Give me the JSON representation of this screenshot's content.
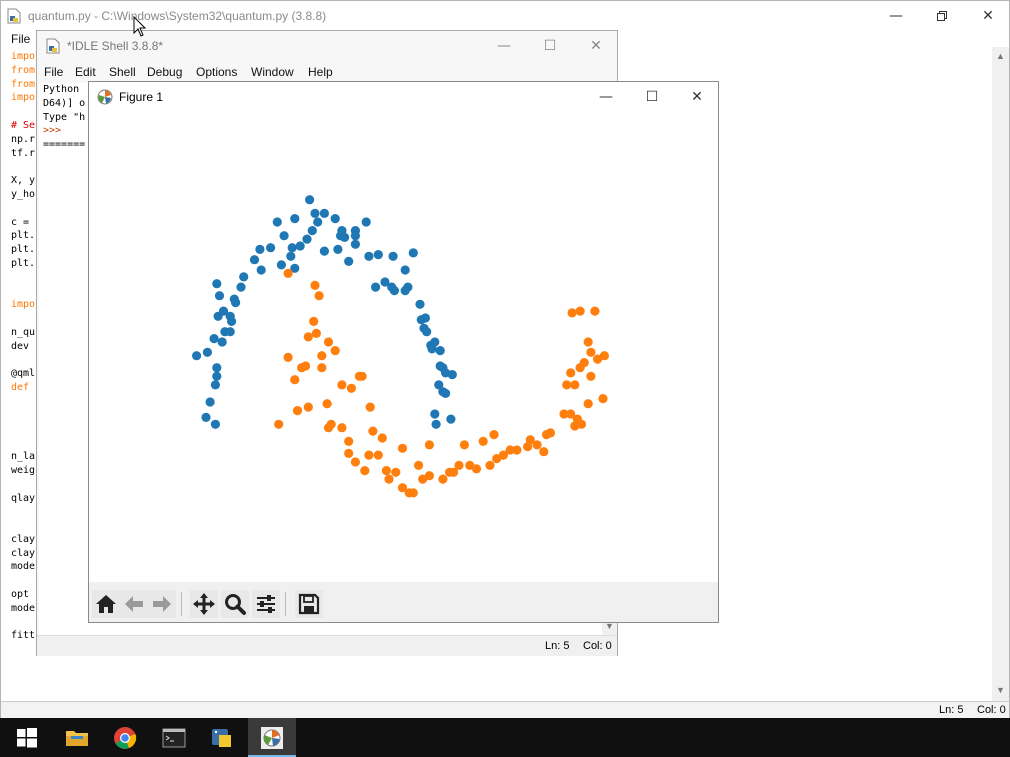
{
  "editor": {
    "title": "quantum.py - C:\\Windows\\System32\\quantum.py (3.8.8)",
    "menu": [
      "File"
    ],
    "code_lines": [
      {
        "text": "impo",
        "color": "#ff7700"
      },
      {
        "text": "from",
        "color": "#ff7700"
      },
      {
        "text": "from",
        "color": "#ff7700"
      },
      {
        "text": "impo",
        "color": "#ff7700"
      },
      {
        "text": "",
        "color": "#000000"
      },
      {
        "text": "# Se",
        "color": "#dd0000"
      },
      {
        "text": "np.r",
        "color": "#000000"
      },
      {
        "text": "tf.r",
        "color": "#000000"
      },
      {
        "text": "",
        "color": "#000000"
      },
      {
        "text": "X, y",
        "color": "#000000"
      },
      {
        "text": "y_ho",
        "color": "#000000"
      },
      {
        "text": "",
        "color": "#000000"
      },
      {
        "text": "c = ",
        "color": "#000000"
      },
      {
        "text": "plt.",
        "color": "#000000"
      },
      {
        "text": "plt.",
        "color": "#000000"
      },
      {
        "text": "plt.",
        "color": "#000000"
      },
      {
        "text": "",
        "color": "#000000"
      },
      {
        "text": "",
        "color": "#000000"
      },
      {
        "text": "impo",
        "color": "#ff7700"
      },
      {
        "text": "",
        "color": "#000000"
      },
      {
        "text": "n_qu",
        "color": "#000000"
      },
      {
        "text": "dev ",
        "color": "#000000"
      },
      {
        "text": "",
        "color": "#000000"
      },
      {
        "text": "@qml",
        "color": "#000000"
      },
      {
        "text": "def ",
        "color": "#ff7700"
      },
      {
        "text": "",
        "color": "#000000"
      },
      {
        "text": "",
        "color": "#000000"
      },
      {
        "text": "",
        "color": "#000000"
      },
      {
        "text": "",
        "color": "#000000"
      },
      {
        "text": "n_la",
        "color": "#000000"
      },
      {
        "text": "weig",
        "color": "#000000"
      },
      {
        "text": "",
        "color": "#000000"
      },
      {
        "text": "qlay",
        "color": "#000000"
      },
      {
        "text": "",
        "color": "#000000"
      },
      {
        "text": "",
        "color": "#000000"
      },
      {
        "text": "clay",
        "color": "#000000"
      },
      {
        "text": "clay",
        "color": "#000000"
      },
      {
        "text": "mode",
        "color": "#000000"
      },
      {
        "text": "",
        "color": "#000000"
      },
      {
        "text": "opt ",
        "color": "#000000"
      },
      {
        "text": "mode",
        "color": "#000000"
      },
      {
        "text": "",
        "color": "#000000"
      },
      {
        "text": "fitt",
        "color": "#000000"
      }
    ],
    "status_ln": "Ln: 5",
    "status_col": "Col: 0"
  },
  "shell": {
    "title": "*IDLE Shell 3.8.8*",
    "menu": [
      "File",
      "Edit",
      "Shell",
      "Debug",
      "Options",
      "Window",
      "Help"
    ],
    "lines": [
      {
        "text": "Python",
        "color": "#000000"
      },
      {
        "text": "D64)] o",
        "color": "#000000"
      },
      {
        "text": "Type \"h",
        "color": "#000000"
      },
      {
        "text": ">>>",
        "color": "#c04000"
      },
      {
        "text": "=======",
        "color": "#000000"
      }
    ],
    "status_ln": "Ln: 5",
    "status_col": "Col: 0"
  },
  "figure": {
    "title": "Figure 1",
    "toolbar": [
      "home-icon",
      "back-icon",
      "forward-icon",
      "pan-icon",
      "zoom-icon",
      "configure-icon",
      "save-icon"
    ]
  },
  "colors": {
    "series_blue": "#1f77b4",
    "series_orange": "#ff7f0e",
    "idle_keyword": "#ff7700",
    "idle_comment": "#dd0000"
  },
  "chart_data": {
    "type": "scatter",
    "xlim": [
      -1.25,
      2.25
    ],
    "ylim": [
      -0.75,
      1.35
    ],
    "series": [
      {
        "color": "#1f77b4",
        "points": [
          [
            -1.03,
            0.22
          ],
          [
            -0.93,
            -0.05
          ],
          [
            -0.96,
            -0.14
          ],
          [
            -0.89,
            -0.18
          ],
          [
            -0.95,
            0.24
          ],
          [
            -0.9,
            0.32
          ],
          [
            -0.89,
            0.05
          ],
          [
            -0.88,
            0.1
          ],
          [
            -0.84,
            0.3
          ],
          [
            -0.88,
            0.15
          ],
          [
            -0.87,
            0.45
          ],
          [
            -0.83,
            0.48
          ],
          [
            -0.78,
            0.45
          ],
          [
            -0.82,
            0.36
          ],
          [
            -0.78,
            0.36
          ],
          [
            -0.77,
            0.42
          ],
          [
            -0.75,
            0.55
          ],
          [
            -0.74,
            0.53
          ],
          [
            -0.7,
            0.62
          ],
          [
            -0.68,
            0.68
          ],
          [
            -0.88,
            0.64
          ],
          [
            -0.86,
            0.57
          ],
          [
            -0.56,
            0.84
          ],
          [
            -0.48,
            0.85
          ],
          [
            -0.43,
            1.0
          ],
          [
            -0.38,
            0.92
          ],
          [
            -0.3,
            1.02
          ],
          [
            -0.19,
            1.13
          ],
          [
            -0.33,
            0.8
          ],
          [
            -0.21,
            0.9
          ],
          [
            -0.15,
            1.05
          ],
          [
            -0.08,
            1.05
          ],
          [
            0.0,
            1.02
          ],
          [
            -0.32,
            0.85
          ],
          [
            -0.26,
            0.86
          ],
          [
            -0.17,
            0.95
          ],
          [
            0.05,
            0.95
          ],
          [
            0.15,
            0.95
          ],
          [
            0.23,
            1.0
          ],
          [
            0.04,
            0.92
          ],
          [
            0.07,
            0.91
          ],
          [
            0.15,
            0.87
          ],
          [
            0.25,
            0.8
          ],
          [
            0.32,
            0.81
          ],
          [
            0.43,
            0.8
          ],
          [
            0.44,
            0.6
          ],
          [
            0.42,
            0.62
          ],
          [
            0.58,
            0.82
          ],
          [
            0.52,
            0.72
          ],
          [
            0.54,
            0.62
          ],
          [
            0.52,
            0.6
          ],
          [
            0.37,
            0.65
          ],
          [
            0.63,
            0.52
          ],
          [
            0.66,
            0.38
          ],
          [
            0.68,
            0.36
          ],
          [
            0.71,
            0.28
          ],
          [
            0.74,
            0.3
          ],
          [
            0.78,
            0.25
          ],
          [
            0.8,
            0.15
          ],
          [
            0.82,
            0.12
          ],
          [
            0.77,
            0.05
          ],
          [
            0.8,
            0.01
          ],
          [
            0.82,
            0.0
          ],
          [
            0.74,
            -0.12
          ],
          [
            0.86,
            -0.15
          ],
          [
            0.75,
            -0.18
          ],
          [
            0.87,
            0.11
          ],
          [
            0.72,
            0.26
          ],
          [
            -0.13,
            1.0
          ],
          [
            -0.6,
            0.78
          ],
          [
            -0.55,
            0.72
          ],
          [
            -0.3,
            0.73
          ],
          [
            -0.4,
            0.75
          ],
          [
            0.15,
            0.92
          ],
          [
            0.3,
            0.62
          ],
          [
            0.1,
            0.77
          ],
          [
            0.02,
            0.84
          ],
          [
            -0.08,
            0.83
          ],
          [
            0.67,
            0.44
          ],
          [
            0.64,
            0.43
          ],
          [
            0.78,
            0.16
          ]
        ]
      },
      {
        "color": "#ff7f0e",
        "points": [
          [
            -0.12,
            0.57
          ],
          [
            -0.22,
            0.16
          ],
          [
            -0.3,
            0.08
          ],
          [
            -0.42,
            -0.18
          ],
          [
            -0.28,
            -0.1
          ],
          [
            -0.2,
            -0.08
          ],
          [
            -0.25,
            0.15
          ],
          [
            -0.2,
            0.33
          ],
          [
            -0.16,
            0.42
          ],
          [
            -0.14,
            0.35
          ],
          [
            -0.06,
            -0.06
          ],
          [
            -0.03,
            -0.18
          ],
          [
            -0.05,
            -0.2
          ],
          [
            0.05,
            -0.2
          ],
          [
            0.1,
            -0.28
          ],
          [
            0.1,
            -0.35
          ],
          [
            0.15,
            -0.4
          ],
          [
            0.22,
            -0.45
          ],
          [
            0.25,
            -0.36
          ],
          [
            0.32,
            -0.36
          ],
          [
            0.38,
            -0.45
          ],
          [
            0.4,
            -0.5
          ],
          [
            0.45,
            -0.46
          ],
          [
            0.5,
            -0.55
          ],
          [
            0.55,
            -0.58
          ],
          [
            0.58,
            -0.58
          ],
          [
            0.62,
            -0.42
          ],
          [
            0.65,
            -0.5
          ],
          [
            0.7,
            -0.48
          ],
          [
            0.8,
            -0.5
          ],
          [
            0.85,
            -0.46
          ],
          [
            0.88,
            -0.46
          ],
          [
            0.92,
            -0.42
          ],
          [
            1.0,
            -0.42
          ],
          [
            1.05,
            -0.44
          ],
          [
            1.15,
            -0.42
          ],
          [
            1.2,
            -0.38
          ],
          [
            1.25,
            -0.36
          ],
          [
            1.3,
            -0.33
          ],
          [
            1.35,
            -0.33
          ],
          [
            1.43,
            -0.31
          ],
          [
            1.45,
            -0.27
          ],
          [
            1.5,
            -0.3
          ],
          [
            1.55,
            -0.34
          ],
          [
            1.57,
            -0.24
          ],
          [
            1.6,
            -0.23
          ],
          [
            1.7,
            -0.12
          ],
          [
            1.75,
            -0.12
          ],
          [
            1.8,
            -0.15
          ],
          [
            1.72,
            0.05
          ],
          [
            1.78,
            0.05
          ],
          [
            1.82,
            0.15
          ],
          [
            1.85,
            0.18
          ],
          [
            1.9,
            0.1
          ],
          [
            1.95,
            0.2
          ],
          [
            2.0,
            0.22
          ],
          [
            1.99,
            -0.03
          ],
          [
            1.88,
            -0.06
          ],
          [
            1.83,
            -0.18
          ],
          [
            1.78,
            -0.19
          ],
          [
            1.75,
            0.12
          ],
          [
            1.76,
            0.47
          ],
          [
            1.82,
            0.48
          ],
          [
            1.93,
            0.48
          ],
          [
            1.88,
            0.3
          ],
          [
            1.9,
            0.24
          ],
          [
            0.05,
            0.05
          ],
          [
            0.12,
            0.03
          ],
          [
            0.18,
            0.1
          ],
          [
            0.2,
            0.1
          ],
          [
            0.26,
            -0.08
          ],
          [
            0.28,
            -0.22
          ],
          [
            0.35,
            -0.26
          ],
          [
            0.5,
            -0.32
          ],
          [
            0.7,
            -0.3
          ],
          [
            0.96,
            -0.3
          ],
          [
            1.1,
            -0.28
          ],
          [
            1.18,
            -0.24
          ],
          [
            -0.15,
            0.63
          ],
          [
            -0.35,
            0.21
          ],
          [
            -0.1,
            0.22
          ],
          [
            -0.05,
            0.3
          ],
          [
            -0.1,
            0.15
          ],
          [
            0.0,
            0.25
          ],
          [
            -0.35,
            0.7
          ]
        ]
      }
    ]
  }
}
